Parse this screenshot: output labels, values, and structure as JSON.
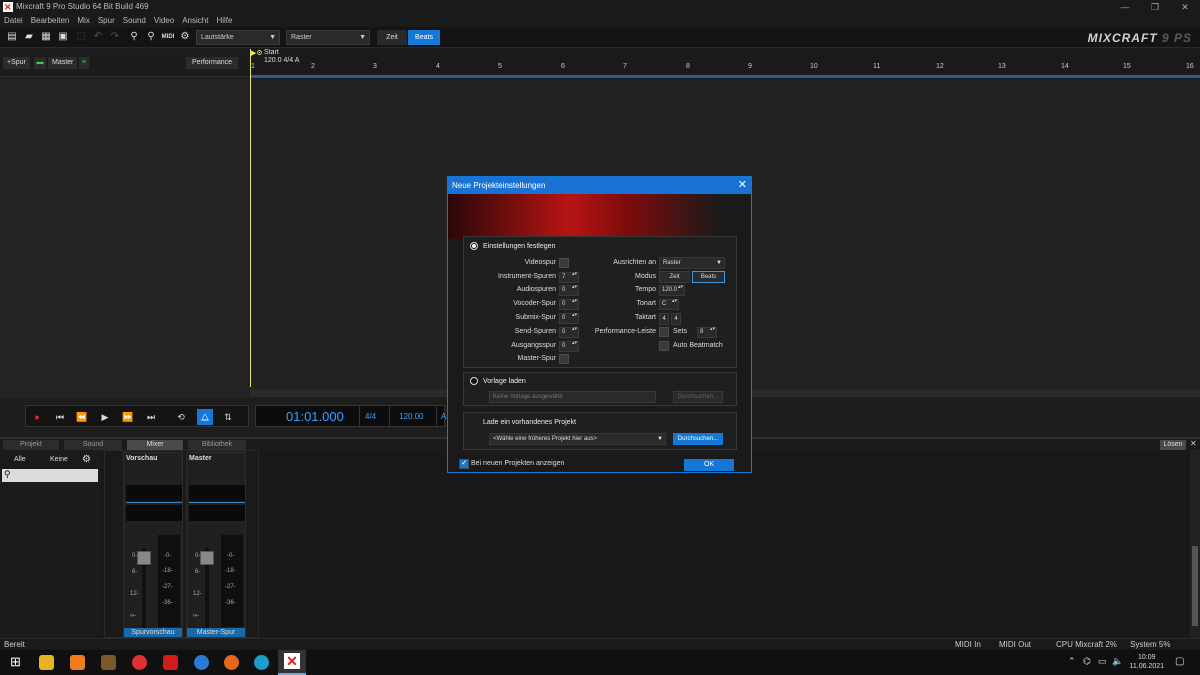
{
  "window": {
    "title": "Mixcraft 9 Pro Studio 64 Bit Build 469"
  },
  "menu": [
    "Datei",
    "Bearbeiten",
    "Mix",
    "Spur",
    "Sound",
    "Video",
    "Ansicht",
    "Hilfe"
  ],
  "toolbar": {
    "midi_label": "MIDI",
    "volume_combo": "Lautstärke",
    "grid_combo": "Raster",
    "time_toggle": "Zeit",
    "beats_toggle": "Beats",
    "logo_main": "MIXCRAFT",
    "logo_ver": "9 PS"
  },
  "track_header": {
    "add_track": "+Spur",
    "master": "Master",
    "performance": "Performance"
  },
  "ruler": {
    "start_label": "Start",
    "tempo_sig": "120.0 4/4 A",
    "ticks": [
      "1",
      "2",
      "3",
      "4",
      "5",
      "6",
      "7",
      "8",
      "9",
      "10",
      "11",
      "12",
      "13",
      "14",
      "15",
      "16"
    ]
  },
  "transport": {
    "time": "01:01.000",
    "signature": "4/4",
    "tempo": "120.00",
    "key": "A"
  },
  "tabs": {
    "projekt": "Projekt",
    "sound": "Sound",
    "mixer": "Mixer",
    "bibliothek": "Bibliothek",
    "losen": "Lösen"
  },
  "mixer": {
    "all": "Alle",
    "none": "Keine",
    "strips": [
      {
        "name": "Vorschau",
        "label": "Spurvorschau"
      },
      {
        "name": "Master",
        "label": "Master-Spur"
      }
    ],
    "scale_left": [
      "0-",
      "6-",
      "12-",
      "∞-"
    ],
    "scale_right": [
      "-0-",
      "-18-",
      "-27-",
      "-36-"
    ]
  },
  "status": {
    "ready": "Bereit",
    "midi_in": "MIDI In",
    "midi_out": "MIDI Out",
    "cpu": "CPU Mixcraft 2%",
    "system": "System 5%"
  },
  "taskbar": {
    "time": "10:09",
    "date": "11.06.2021"
  },
  "dialog": {
    "title": "Neue Projekteinstellungen",
    "section_settings": "Einstellungen festlegen",
    "videospur": "Videospur",
    "instrument_tracks": "Instrument-Spuren",
    "instrument_value": "7",
    "audio_tracks": "Audiospuren",
    "audio_value": "0",
    "vocoder_track": "Vocoder-Spur",
    "vocoder_value": "0",
    "submix_track": "Submix-Spur",
    "submix_value": "0",
    "send_tracks": "Send-Spuren",
    "send_value": "0",
    "output_track": "Ausgangsspur",
    "output_value": "0",
    "master_track": "Master-Spur",
    "align_label": "Ausrichten an",
    "align_value": "Raster",
    "mode_label": "Modus",
    "mode_time": "Zeit",
    "mode_beats": "Beats",
    "tempo_label": "Tempo",
    "tempo_value": "120.0",
    "key_label": "Tonart",
    "key_value": "C",
    "timesig_label": "Taktart",
    "timesig_num": "4",
    "timesig_den": "4",
    "perf_label": "Performance-Leiste",
    "sets_label": "Sets",
    "sets_value": "8",
    "auto_beatmatch": "Auto Beatmatch",
    "section_template": "Vorlage laden",
    "template_placeholder": "Keine Vorlage ausgewählt",
    "browse1": "Durchsuchen...",
    "section_existing": "Lade ein vorhandenes Projekt",
    "existing_placeholder": "<Wähle eine früheres Projekt hier aus>",
    "browse2": "Durchsuchen...",
    "show_on_new": "Bei neuen Projekten anzeigen",
    "ok": "OK"
  }
}
